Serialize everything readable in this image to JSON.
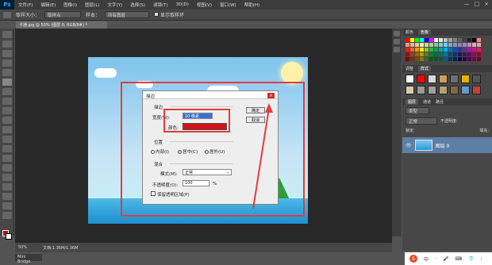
{
  "menubar": {
    "logo": "Ps",
    "items": [
      "文件(F)",
      "编辑(E)",
      "图像(I)",
      "图层(L)",
      "文字(Y)",
      "选择(S)",
      "滤镜(T)",
      "3D(D)",
      "视图(V)",
      "窗口(W)",
      "帮助(H)"
    ],
    "controls": [
      "—",
      "□",
      "×"
    ]
  },
  "options": {
    "size_label": "取样大小：",
    "size_value": "取样点",
    "sample_label": "样本：",
    "sample_value": "所有图层",
    "show_ring": "显示取样环"
  },
  "document": {
    "tab": "卡通.jpg @ 50% (图层 0, RGB/8#) *",
    "zoom": "50%",
    "doc_info": "文档:1.36M/1.36M"
  },
  "dialog": {
    "title": "描边",
    "close": "×",
    "stroke_group": "描边",
    "width_label": "宽度(W):",
    "width_value": "10 像素",
    "color_label": "颜色:",
    "color_value": "#d0121b",
    "position_group": "位置",
    "pos_inside": "内部(I)",
    "pos_center": "居中(C)",
    "pos_outside": "居外(U)",
    "selected_position": "居中(C)",
    "blend_group": "混合",
    "mode_label": "模式(M):",
    "mode_value": "正常",
    "opacity_label": "不透明度(O):",
    "opacity_value": "100",
    "opacity_unit": "%",
    "preserve_label": "保留透明区域(P)",
    "ok": "确定",
    "cancel": "取消"
  },
  "panels": {
    "color_tabs": [
      "颜色",
      "色板"
    ],
    "style_tabs": [
      "调整",
      "样式"
    ],
    "layer_tabs": [
      "图层",
      "通道",
      "路径"
    ],
    "kind_label": "类型",
    "blend_mode": "正常",
    "opacity_label": "不透明度:",
    "lock_label": "锁定:",
    "fill_label": "填充:",
    "layer_name": "图层 0"
  },
  "footer": {
    "minibridge": "Mini Bridge",
    "ime_icon": "S",
    "tray": [
      "中",
      "·",
      "🎤",
      "⌨",
      "👕",
      "⁝"
    ]
  },
  "colors": {
    "annotation_red": "#e33c3c",
    "layer_selected": "#5d7fa6"
  }
}
